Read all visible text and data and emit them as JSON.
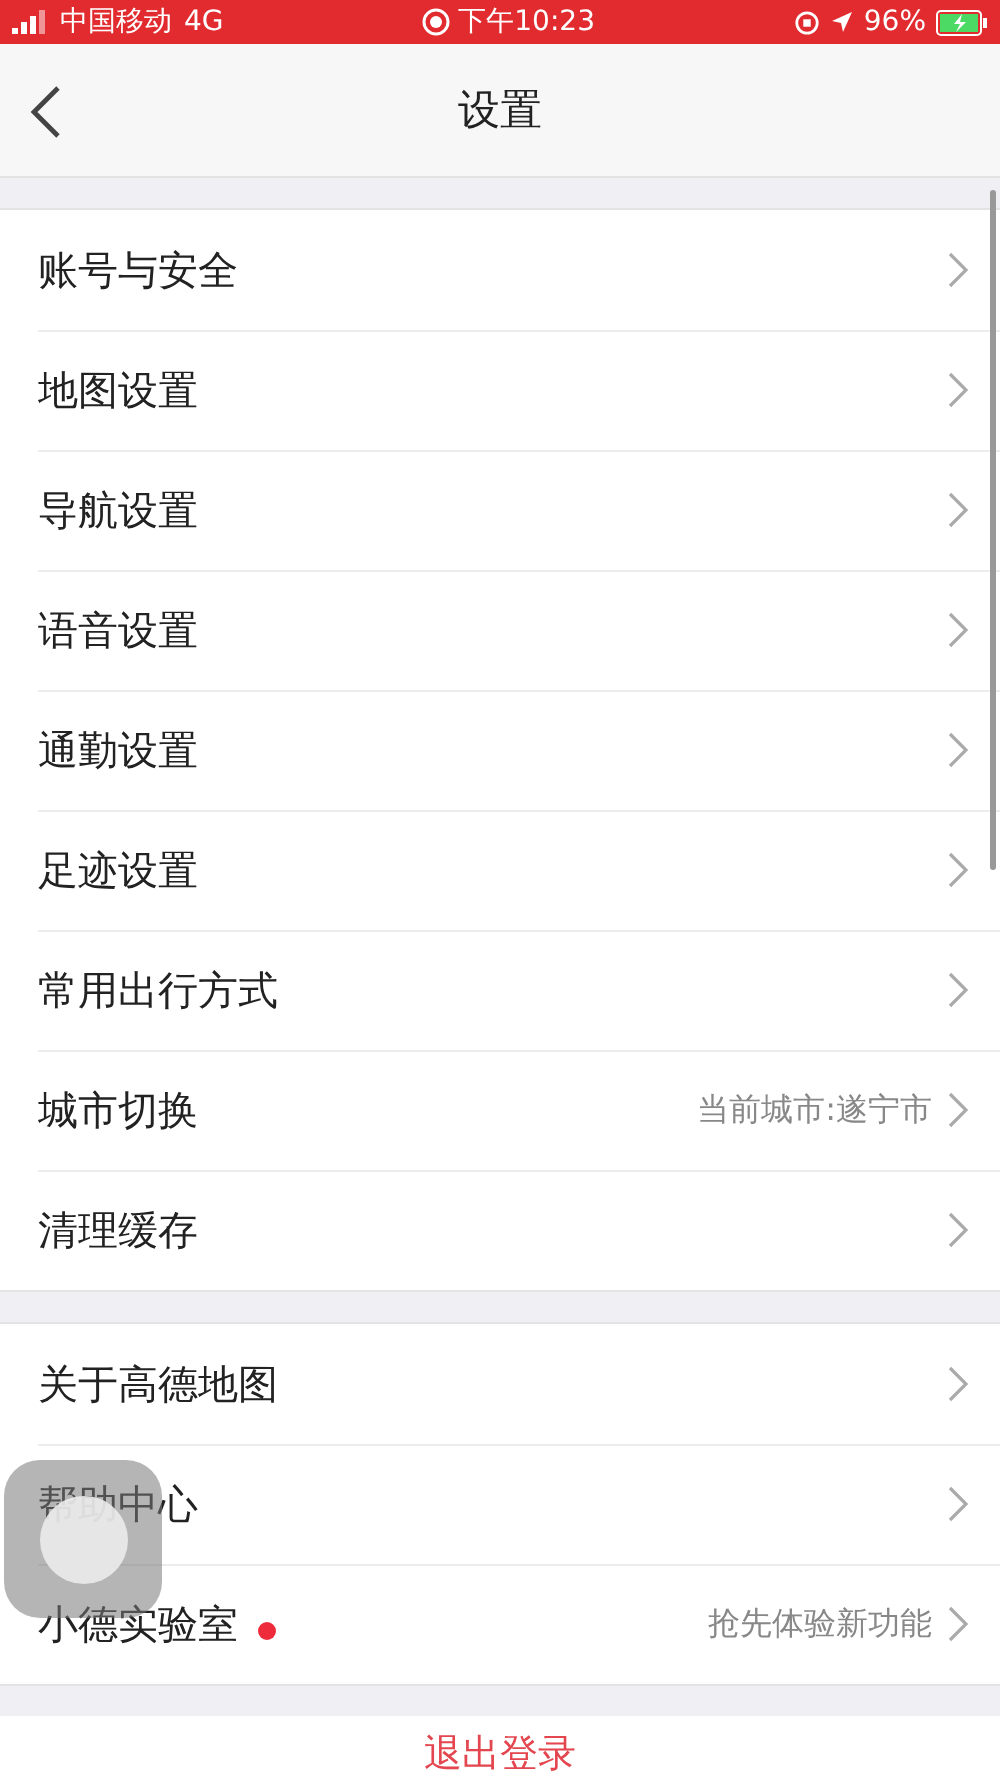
{
  "status_bar": {
    "carrier": "中国移动",
    "network": "4G",
    "time": "下午10:23",
    "battery": "96%"
  },
  "nav": {
    "title": "设置"
  },
  "groups": [
    {
      "items": [
        {
          "label": "账号与安全",
          "dot": false
        },
        {
          "label": "地图设置",
          "dot": false
        },
        {
          "label": "导航设置",
          "dot": false
        },
        {
          "label": "语音设置",
          "dot": false
        },
        {
          "label": "通勤设置",
          "dot": false
        },
        {
          "label": "足迹设置",
          "dot": false
        },
        {
          "label": "常用出行方式",
          "dot": false
        },
        {
          "label": "城市切换",
          "value": "当前城市:遂宁市",
          "dot": false
        },
        {
          "label": "清理缓存",
          "dot": false
        }
      ]
    },
    {
      "items": [
        {
          "label": "关于高德地图",
          "dot": false
        },
        {
          "label": "帮助中心",
          "dot": false
        },
        {
          "label": "小德实验室",
          "value": "抢先体验新功能",
          "dot": true
        }
      ]
    }
  ],
  "logout": {
    "label": "退出登录"
  }
}
